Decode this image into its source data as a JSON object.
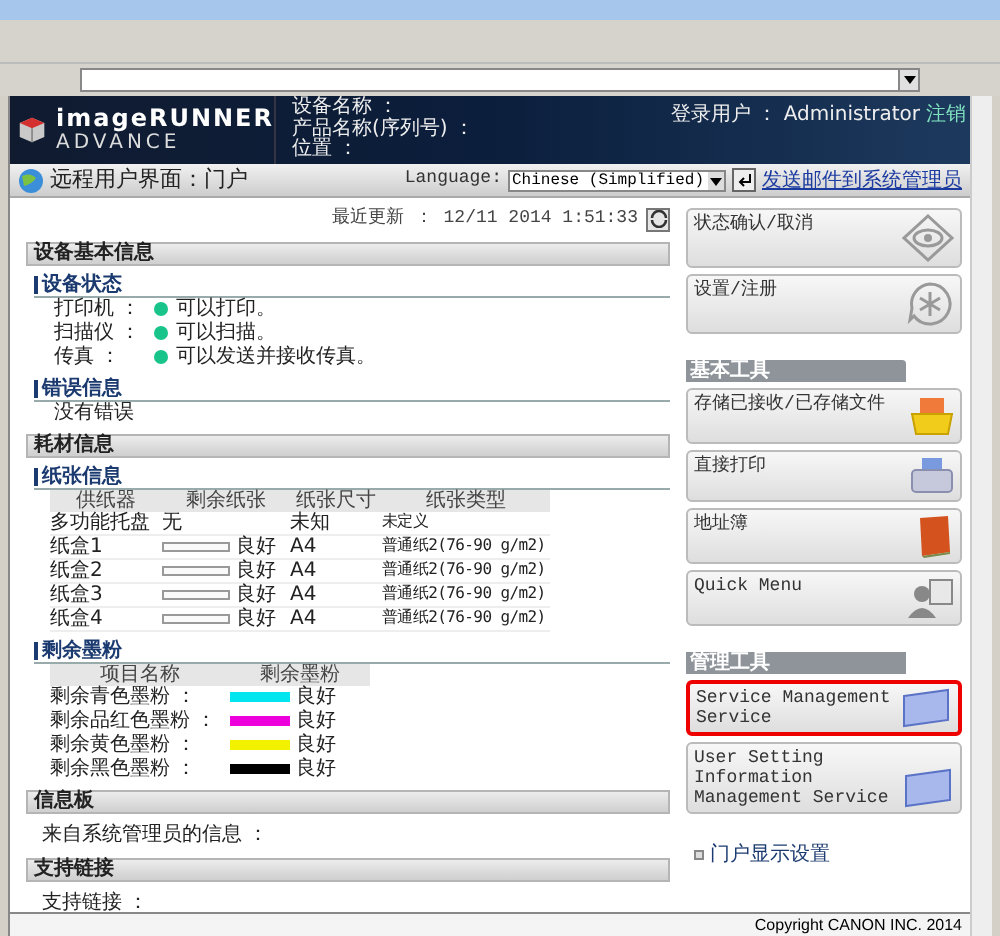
{
  "brand": {
    "line1": "imageRUNNER",
    "line2": "ADVANCE"
  },
  "device_fields": [
    "设备名称 ：",
    "产品名称(序列号) ：",
    "位置 ："
  ],
  "login": {
    "label": "登录用户 ： Administrator",
    "logout": "注销"
  },
  "portal_bar": {
    "title": "远程用户界面：门户",
    "language_label": "Language:",
    "language_value": "Chinese (Simplified)",
    "mail_link": "发送邮件到系统管理员"
  },
  "last_update": "最近更新 ： 12/11 2014 1:51:33",
  "device_info": {
    "title": "设备基本信息",
    "status_title": "设备状态",
    "statuses": [
      {
        "name": "打印机 ：",
        "text": "可以打印。",
        "color": "#19c48a"
      },
      {
        "name": "扫描仪 ：",
        "text": "可以扫描。",
        "color": "#19c48a"
      },
      {
        "name": "传真 ：",
        "text": "可以发送并接收传真。",
        "color": "#19c48a"
      }
    ],
    "error_title": "错误信息",
    "error_text": "没有错误"
  },
  "consumables": {
    "title": "耗材信息",
    "paper_title": "纸张信息",
    "paper_columns": [
      "供纸器",
      "剩余纸张",
      "纸张尺寸",
      "纸张类型"
    ],
    "paper_rows": [
      {
        "source": "多功能托盘",
        "kind": "text",
        "remaining": "无",
        "size": "未知",
        "type": "未定义"
      },
      {
        "source": "纸盒1",
        "kind": "bar",
        "remaining": "良好",
        "size": "A4",
        "type": "普通纸2(76-90 g/m2)"
      },
      {
        "source": "纸盒2",
        "kind": "bar",
        "remaining": "良好",
        "size": "A4",
        "type": "普通纸2(76-90 g/m2)"
      },
      {
        "source": "纸盒3",
        "kind": "bar",
        "remaining": "良好",
        "size": "A4",
        "type": "普通纸2(76-90 g/m2)"
      },
      {
        "source": "纸盒4",
        "kind": "bar",
        "remaining": "良好",
        "size": "A4",
        "type": "普通纸2(76-90 g/m2)"
      }
    ],
    "toner_title": "剩余墨粉",
    "toner_columns": [
      "项目名称",
      "剩余墨粉"
    ],
    "toner_rows": [
      {
        "name": "剩余青色墨粉 ：",
        "color": "#00e5ee",
        "status": "良好"
      },
      {
        "name": "剩余品红色墨粉 ：",
        "color": "#ee00dd",
        "status": "良好"
      },
      {
        "name": "剩余黄色墨粉 ：",
        "color": "#f2f200",
        "status": "良好"
      },
      {
        "name": "剩余黑色墨粉 ：",
        "color": "#000000",
        "status": "良好"
      }
    ]
  },
  "message_board": {
    "title": "信息板",
    "text": "来自系统管理员的信息 ："
  },
  "support_link": {
    "title": "支持链接",
    "text": "支持链接 ："
  },
  "top_buttons": [
    {
      "label": "状态确认/取消",
      "highlighted": false
    },
    {
      "label": "设置/注册",
      "highlighted": false
    }
  ],
  "basic_tools": {
    "title": "基本工具",
    "buttons": [
      {
        "label": "存储已接收/已存储文件",
        "highlighted": false
      },
      {
        "label": "直接打印",
        "highlighted": false
      },
      {
        "label": "地址簿",
        "highlighted": false
      },
      {
        "label": "Quick Menu",
        "highlighted": false
      }
    ]
  },
  "management_tools": {
    "title": "管理工具",
    "buttons": [
      {
        "label": "Service Management Service",
        "highlighted": true
      },
      {
        "label": "User Setting Information Management Service",
        "highlighted": false
      }
    ]
  },
  "portal_settings_link": "门户显示设置",
  "copyright": "Copyright CANON INC. 2014"
}
